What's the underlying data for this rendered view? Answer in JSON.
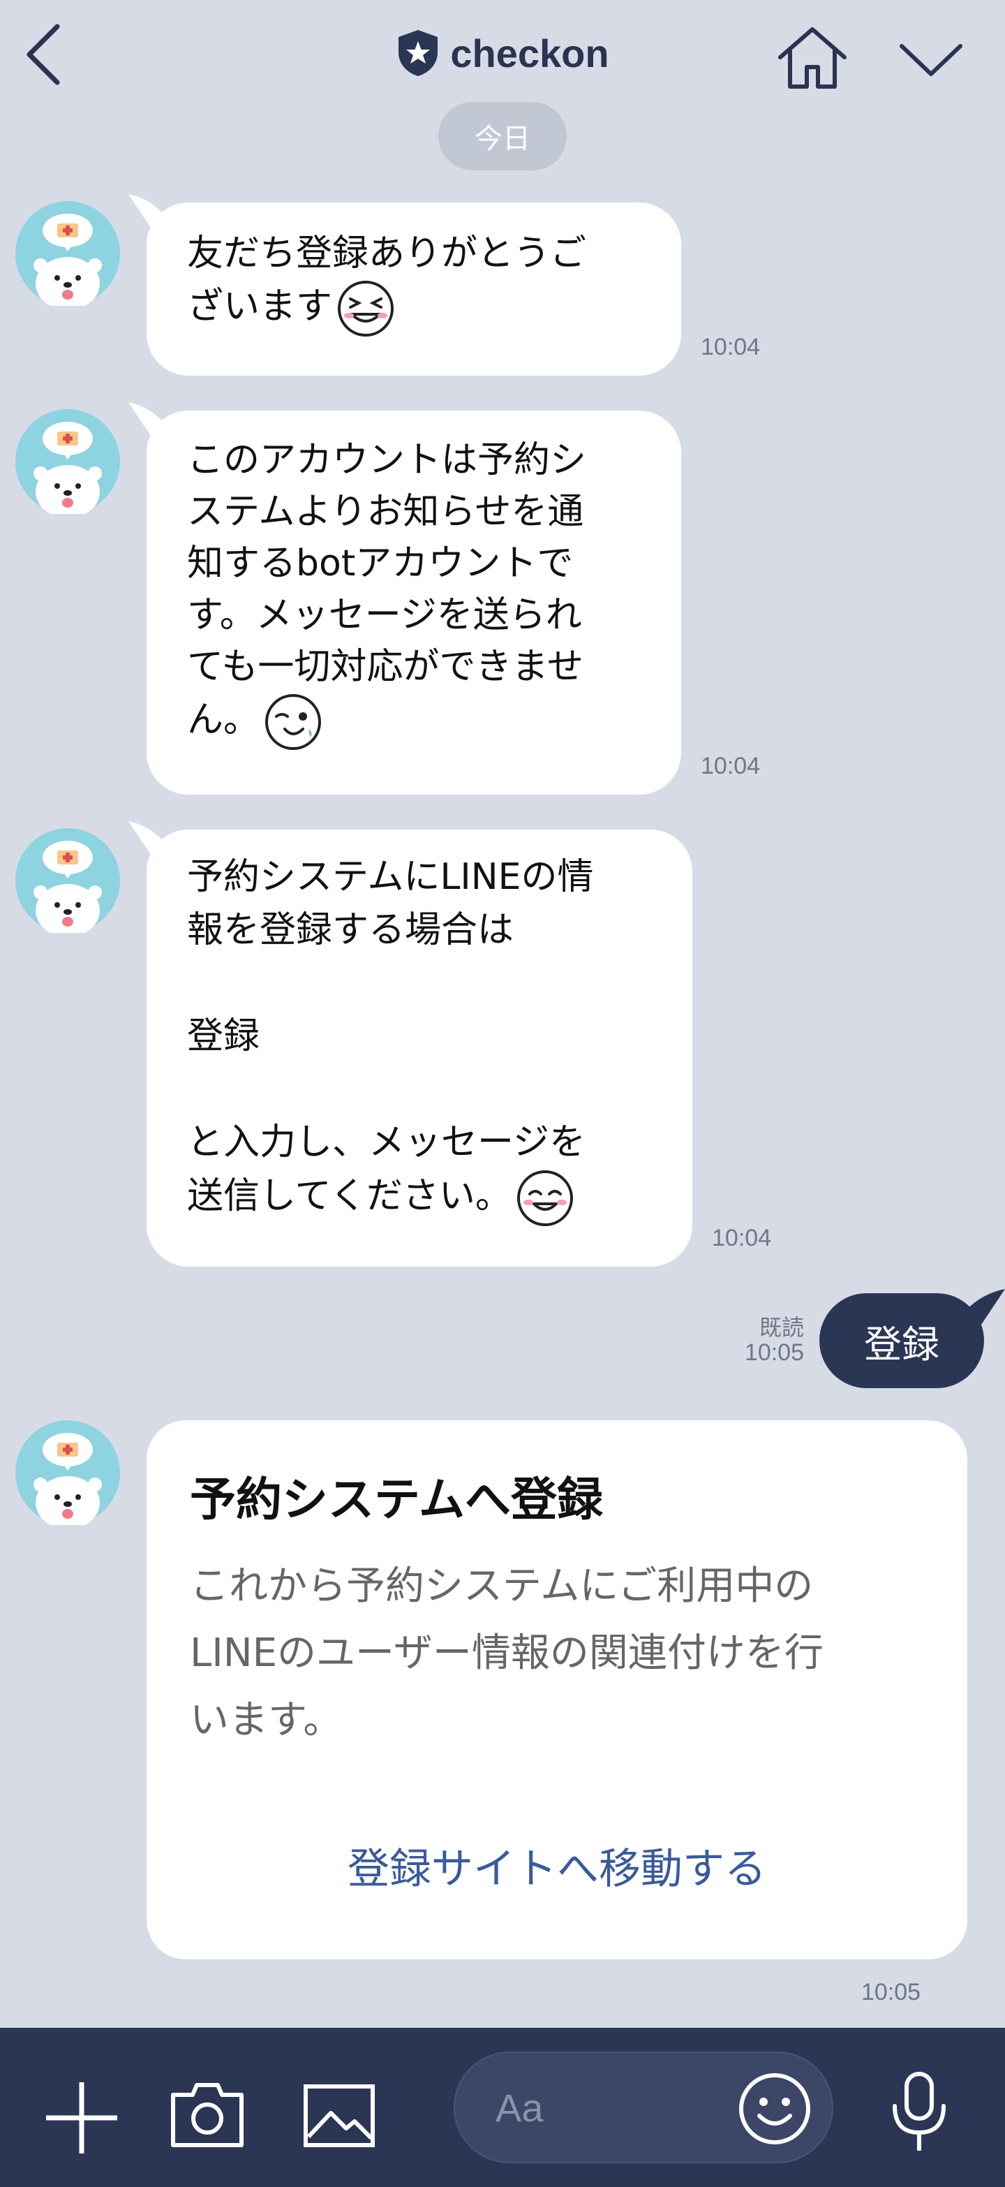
{
  "header": {
    "title": "checkon",
    "date_label": "今日"
  },
  "messages": [
    {
      "text": "友だち登録ありがとうご\nざいます",
      "time": "10:04",
      "emoji": "grinning-emoji"
    },
    {
      "text": "このアカウントは予約シ\nステムよりお知らせを通\n知するbotアカウントで\nす。メッセージを送られ\nても一切対応ができませ\nん。",
      "time": "10:04",
      "emoji": "wink-emoji"
    },
    {
      "text": "予約システムにLINEの情\n報を登録する場合は\n\n登録\n\nと入力し、メッセージを\n送信してください。",
      "time": "10:04",
      "emoji": "smile-emoji"
    }
  ],
  "outgoing": {
    "text": "登録",
    "read_label": "既読",
    "time": "10:05"
  },
  "card": {
    "title": "予約システムへ登録",
    "body": "これから予約システムにご利用中の\nLINEのユーザー情報の関連付けを行\nいます。",
    "link_label": "登録サイトへ移動する",
    "time": "10:05"
  },
  "input": {
    "placeholder": "Aa"
  },
  "colors": {
    "background": "#d7dbe6",
    "navy": "#2b3655",
    "link": "#3a5a9a"
  }
}
